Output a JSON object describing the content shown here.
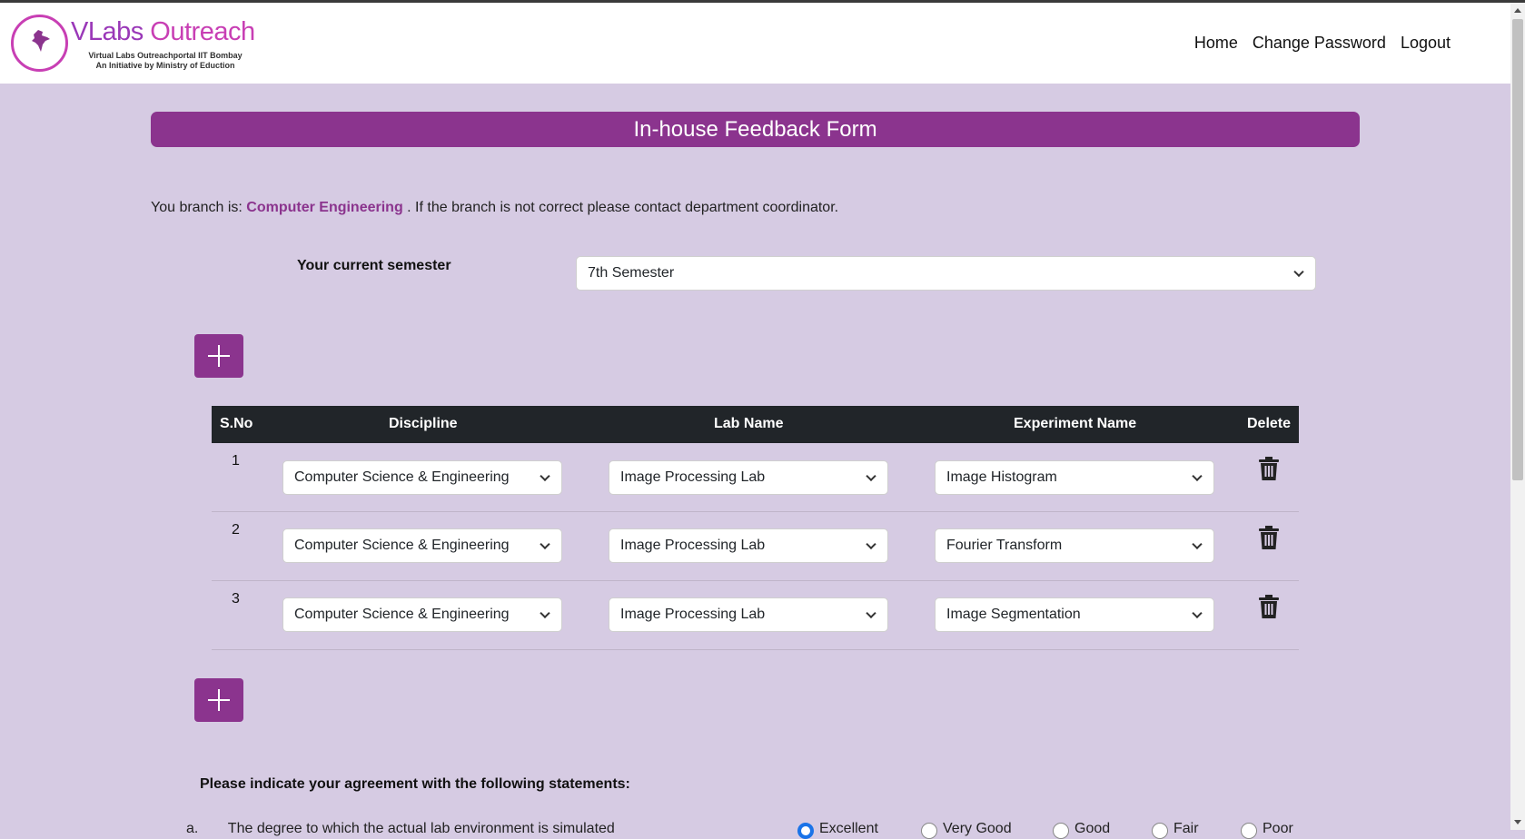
{
  "brand": {
    "title_v": "VLabs ",
    "title_rest": "Outreach",
    "subtitle1": "Virtual Labs Outreachportal IIT Bombay",
    "subtitle2": "An Initiative by Ministry of Eduction"
  },
  "nav": {
    "home": "Home",
    "change_password": "Change Password",
    "logout": "Logout"
  },
  "form": {
    "header": "In-house Feedback Form",
    "branch_prefix": "You branch is: ",
    "branch_value": "Computer Engineering",
    "branch_suffix": " . If the branch is not correct please contact department coordinator.",
    "semester_label": "Your current semester",
    "semester_value": "7th Semester"
  },
  "table": {
    "headers": {
      "sno": "S.No",
      "discipline": "Discipline",
      "lab": "Lab Name",
      "experiment": "Experiment Name",
      "delete": "Delete"
    },
    "rows": [
      {
        "sno": "1",
        "discipline": "Computer Science & Engineering",
        "lab": "Image Processing Lab",
        "experiment": "Image Histogram"
      },
      {
        "sno": "2",
        "discipline": "Computer Science & Engineering",
        "lab": "Image Processing Lab",
        "experiment": "Fourier Transform"
      },
      {
        "sno": "3",
        "discipline": "Computer Science & Engineering",
        "lab": "Image Processing Lab",
        "experiment": "Image Segmentation"
      }
    ]
  },
  "agreement": {
    "title": "Please indicate your agreement with the following statements:",
    "statement_index": "a.",
    "statement_text": "The degree to which the actual lab environment is simulated",
    "options": [
      "Excellent",
      "Very Good",
      "Good",
      "Fair",
      "Poor"
    ],
    "selected": "Excellent"
  },
  "icons": {
    "add": "plus-icon",
    "delete": "trash-icon",
    "dropdown": "chevron-down-icon"
  },
  "colors": {
    "accent": "#8b348e",
    "background": "#d6cbe3",
    "table_header": "#212529"
  }
}
